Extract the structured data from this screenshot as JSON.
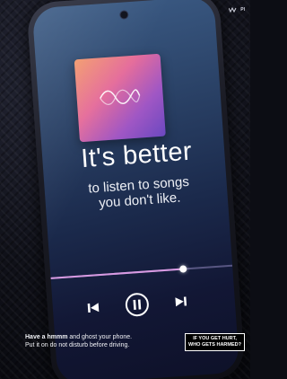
{
  "brand": {
    "sponsor_label": "Pl",
    "logo_icon": "wave-logo-icon"
  },
  "screen": {
    "album_art_icon": "sound-wave-icon",
    "headline": "It's better",
    "sublines": [
      "to listen to songs",
      "you don't like."
    ],
    "progress": 0.73,
    "controls": {
      "previous_icon": "skip-previous-icon",
      "pause_icon": "pause-circle-icon",
      "next_icon": "skip-next-icon"
    }
  },
  "caption": {
    "bold": "Have a hmmm",
    "line1_rest": " and ghost your phone.",
    "line2": "Put it on do not disturb before driving."
  },
  "badge": {
    "line1": "IF YOU GET HURT,",
    "line2": "WHO GETS HARMED?"
  },
  "colors": {
    "screen_top": "#3c5c86",
    "screen_bottom": "#0e1129",
    "album_gradient": [
      "#f29a6c",
      "#e56d9b",
      "#a057c4",
      "#6b48c0"
    ],
    "progress_fill": "#d89ae2"
  }
}
